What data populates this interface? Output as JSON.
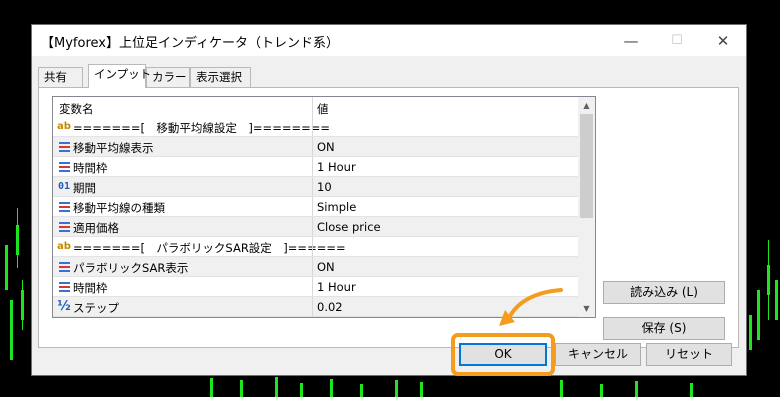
{
  "window": {
    "title": "【Myforex】上位足インディケータ（トレンド系）",
    "minimize": "—",
    "maximize": "☐",
    "close": "✕"
  },
  "tabs": [
    {
      "label": "共有",
      "active": false
    },
    {
      "label": "インプット",
      "active": true
    },
    {
      "label": "カラー",
      "active": false
    },
    {
      "label": "表示選択",
      "active": false
    }
  ],
  "grid": {
    "col_name": "変数名",
    "col_value": "値",
    "rows": [
      {
        "icon": "ab-icon",
        "name": "=======[　移動平均線設定　]========",
        "value": ""
      },
      {
        "icon": "enum-icon",
        "name": "移動平均線表示",
        "value": "ON"
      },
      {
        "icon": "enum-icon",
        "name": "時間枠",
        "value": "1 Hour"
      },
      {
        "icon": "int-icon",
        "name": "期間",
        "value": "10"
      },
      {
        "icon": "enum-icon",
        "name": "移動平均線の種類",
        "value": "Simple"
      },
      {
        "icon": "enum-icon",
        "name": "適用価格",
        "value": "Close price"
      },
      {
        "icon": "ab-icon",
        "name": "=======[　パラボリックSAR設定　]======",
        "value": ""
      },
      {
        "icon": "enum-icon",
        "name": "パラボリックSAR表示",
        "value": "ON"
      },
      {
        "icon": "enum-icon",
        "name": "時間枠",
        "value": "1 Hour"
      },
      {
        "icon": "half-icon",
        "name": "ステップ",
        "value": "0.02"
      }
    ],
    "icon_glyphs": {
      "ab": "ab",
      "int": "01",
      "half": "½"
    }
  },
  "side_buttons": {
    "load": "読み込み (L)",
    "save": "保存 (S)"
  },
  "footer_buttons": {
    "ok": "OK",
    "cancel": "キャンセル",
    "reset": "リセット"
  },
  "colors": {
    "highlight": "#f39c1e",
    "default_button_border": "#0078d7",
    "chart_candles": "#1ee61e"
  }
}
